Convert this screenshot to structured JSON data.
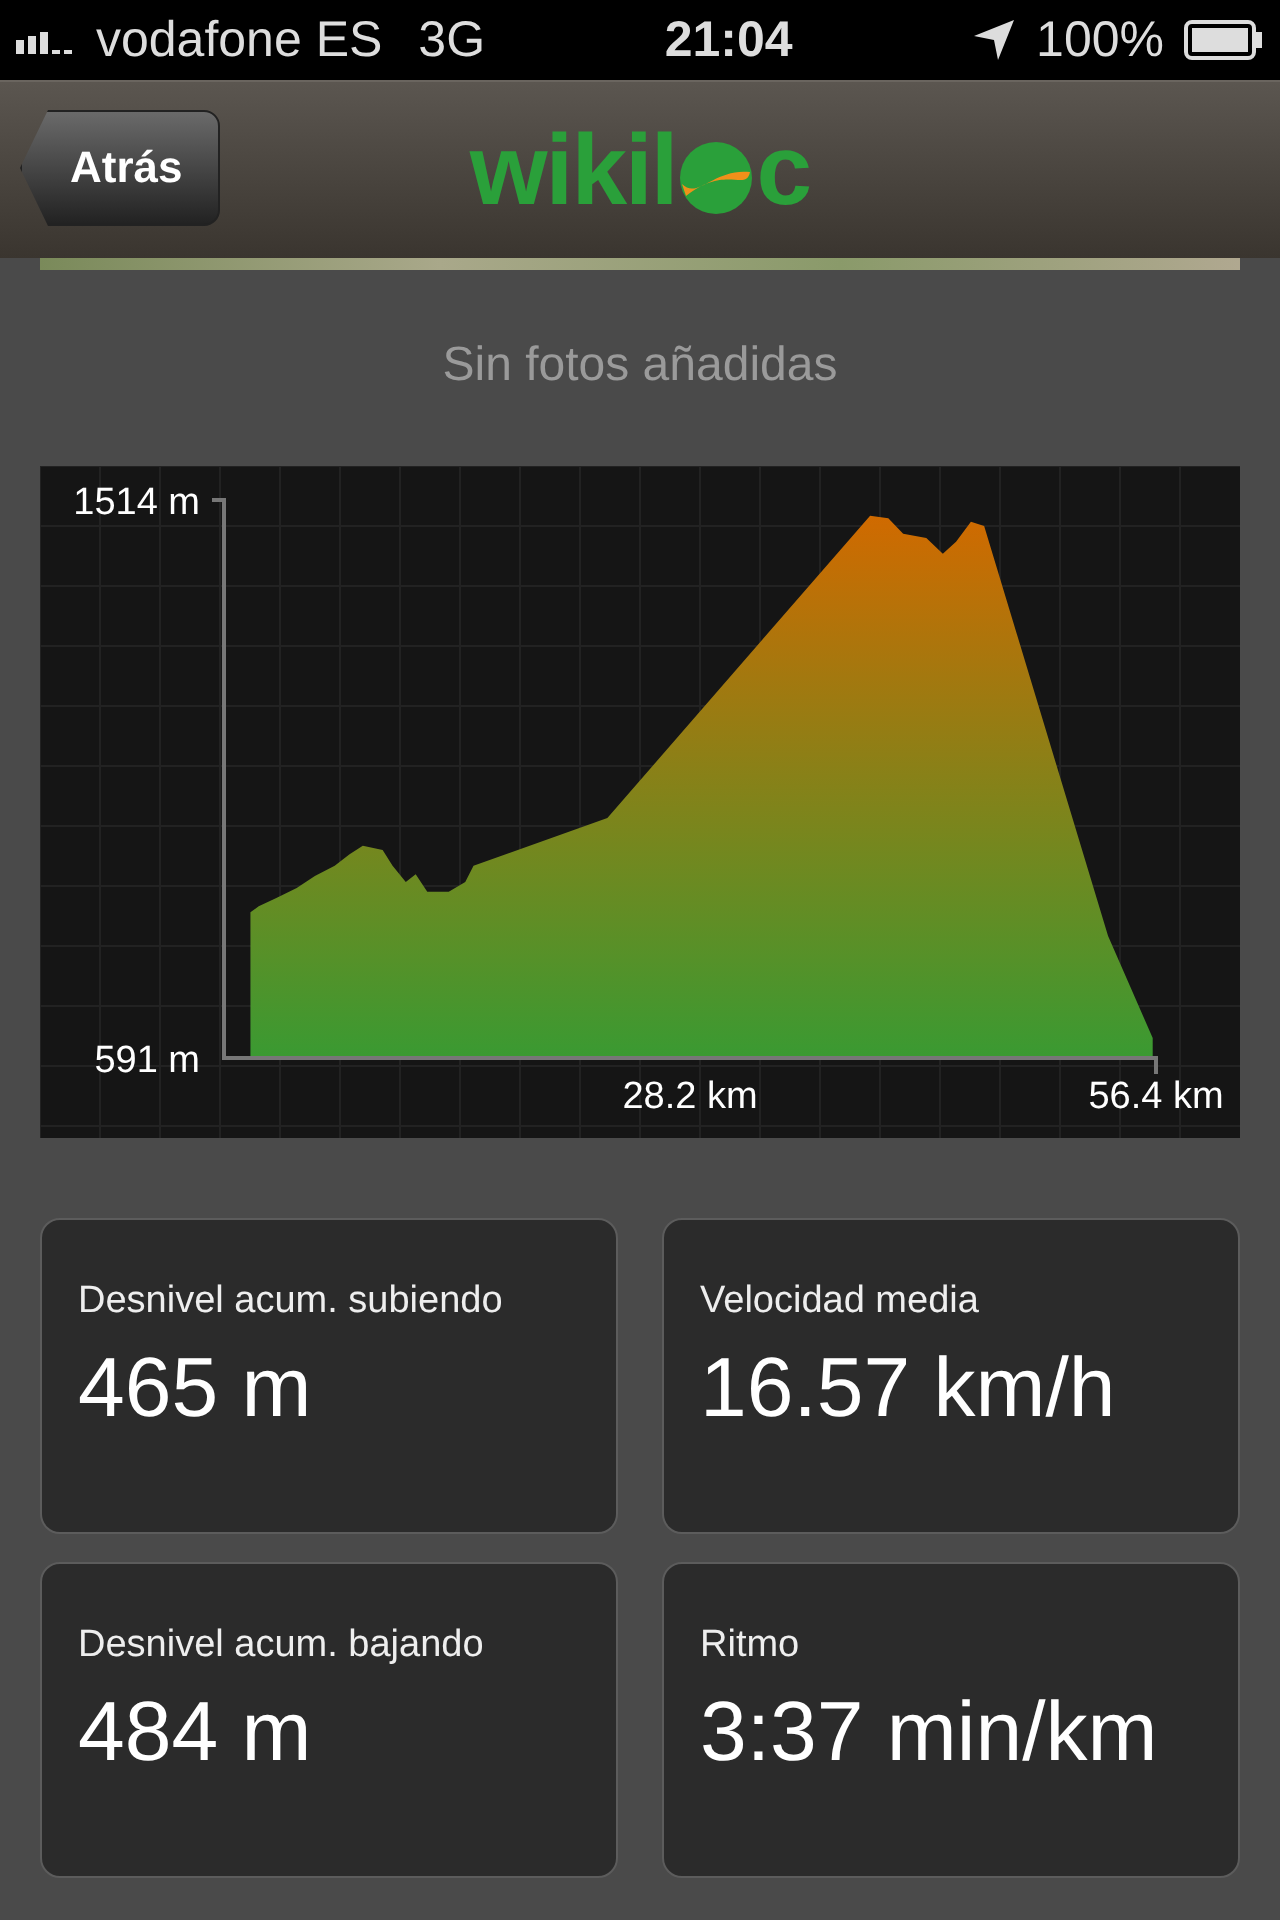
{
  "status_bar": {
    "carrier": "vodafone ES",
    "network": "3G",
    "time": "21:04",
    "battery": "100%"
  },
  "nav_bar": {
    "back_button": "Atrás",
    "logo_parts": [
      "wikil",
      "c"
    ]
  },
  "photos_message": "Sin fotos añadidas",
  "elevation_profile": {
    "chart_data": {
      "type": "area",
      "xlim": [
        0,
        56.4
      ],
      "ylim": [
        591,
        1514
      ],
      "yticks": [
        {
          "value": 591,
          "label": "591 m"
        },
        {
          "value": 1514,
          "label": "1514 m"
        }
      ],
      "xticks": [
        {
          "value": 28.2,
          "label": "28.2 km"
        },
        {
          "value": 56.4,
          "label": "56.4 km"
        }
      ],
      "x": [
        1.6,
        2.1,
        3.2,
        4.4,
        5.5,
        6.7,
        7.6,
        8.4,
        9.6,
        10.2,
        11.0,
        11.6,
        12.3,
        13.6,
        14.6,
        15.1,
        23.2,
        39.1,
        40.2,
        41.1,
        42.5,
        43.5,
        44.3,
        45.2,
        46.0,
        53.5,
        56.2
      ],
      "series": [
        {
          "color": "#3a9a32",
          "values": [
            832,
            842,
            856,
            872,
            892,
            909,
            928,
            942,
            935,
            909,
            882,
            895,
            866,
            866,
            882,
            909,
            988,
            1488,
            1484,
            1458,
            1451,
            1425,
            1445,
            1478,
            1471,
            793,
            624
          ]
        }
      ]
    }
  },
  "stats": [
    {
      "label": "Desnivel acum. subiendo",
      "value": "465 m"
    },
    {
      "label": "Velocidad media",
      "value": "16.57 km/h"
    },
    {
      "label": "Desnivel acum. bajando",
      "value": "484 m"
    },
    {
      "label": "Ritmo",
      "value": "3:37 min/km"
    }
  ]
}
